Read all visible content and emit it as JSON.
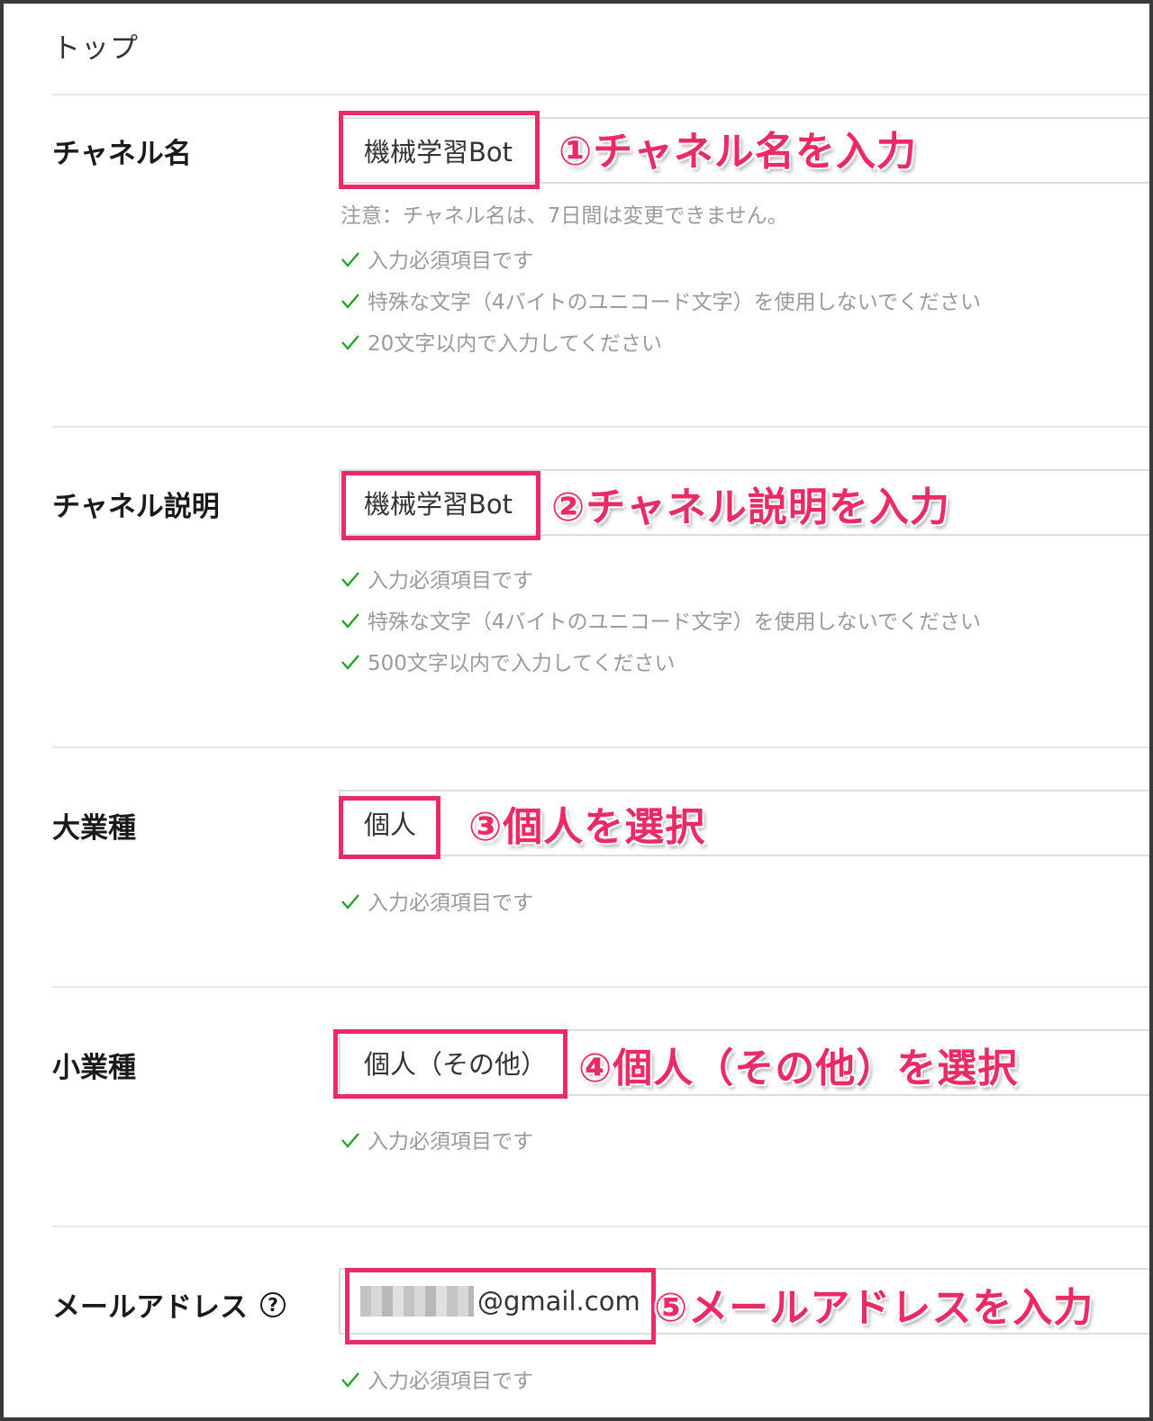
{
  "breadcrumb": "トップ",
  "colors": {
    "annotation": "#ec2a64",
    "check": "#1aa31a",
    "hint": "#9a9a9a"
  },
  "channel_name": {
    "label": "チャネル名",
    "value": "機械学習Bot",
    "annotation": "①チャネル名を入力",
    "note": "注意：チャネル名は、7日間は変更できません。",
    "rules": [
      "入力必須項目です",
      "特殊な文字（4バイトのユニコード文字）を使用しないでください",
      "20文字以内で入力してください"
    ]
  },
  "channel_description": {
    "label": "チャネル説明",
    "value": "機械学習Bot",
    "annotation": "②チャネル説明を入力",
    "rules": [
      "入力必須項目です",
      "特殊な文字（4バイトのユニコード文字）を使用しないでください",
      "500文字以内で入力してください"
    ]
  },
  "major_industry": {
    "label": "大業種",
    "value": "個人",
    "annotation": "③個人を選択",
    "rules": [
      "入力必須項目です"
    ]
  },
  "minor_industry": {
    "label": "小業種",
    "value": "個人（その他）",
    "annotation": "④個人（その他）を選択",
    "rules": [
      "入力必須項目です"
    ]
  },
  "email": {
    "label": "メールアドレス",
    "help_icon": "question-circle-icon",
    "help_glyph": "?",
    "value": "@gmail.com",
    "annotation": "⑤メールアドレスを入力",
    "rules": [
      "入力必須項目です"
    ]
  }
}
